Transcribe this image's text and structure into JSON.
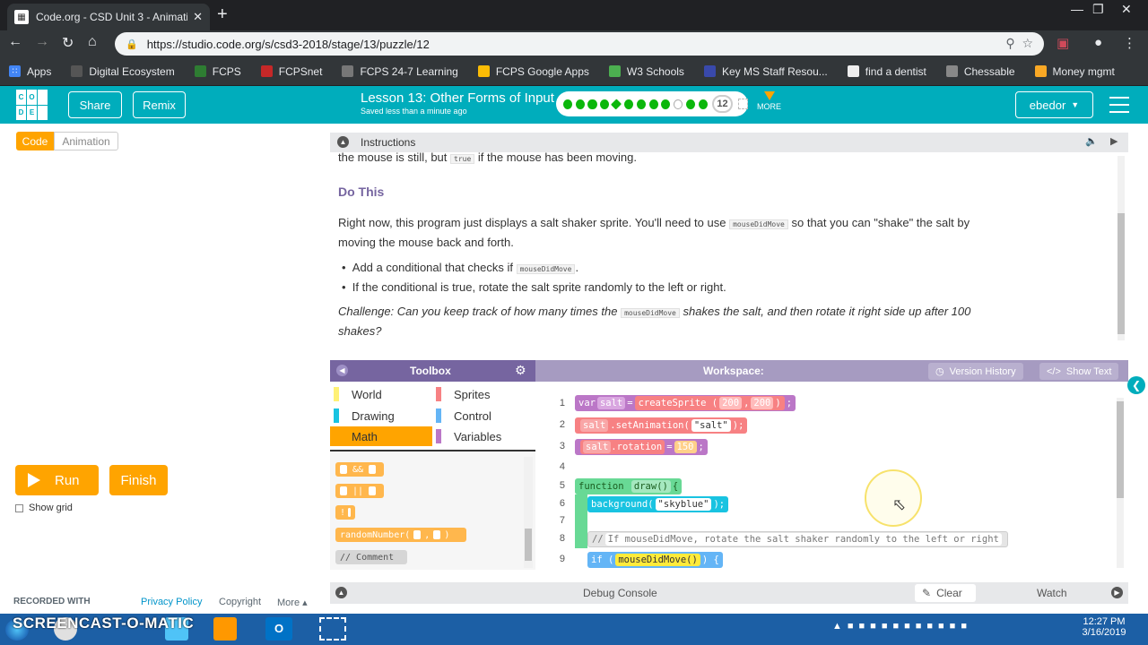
{
  "browser": {
    "tab_title": "Code.org - CSD Unit 3 - Animatio",
    "url": "https://studio.code.org/s/csd3-2018/stage/13/puzzle/12",
    "bookmarks": [
      "Apps",
      "Digital Ecosystem",
      "FCPS",
      "FCPSnet",
      "FCPS 24-7 Learning",
      "FCPS Google Apps",
      "W3 Schools",
      "Key MS Staff Resou...",
      "find a dentist",
      "Chessable",
      "Money mgmt"
    ]
  },
  "header": {
    "logo_letters": [
      "C",
      "O",
      "",
      "D",
      "E",
      ""
    ],
    "share_label": "Share",
    "remix_label": "Remix",
    "lesson_title": "Lesson 13: Other Forms of Input",
    "saved_text": "Saved less than a minute ago",
    "current_level": "12",
    "more_label": "MORE",
    "username": "ebedor"
  },
  "left": {
    "code_tab": "Code",
    "animation_tab": "Animation",
    "run_label": "Run",
    "finish_label": "Finish",
    "show_grid_label": "Show grid",
    "footer_recorded": "RECORDED WITH",
    "footer_privacy": "Privacy Policy",
    "footer_copyright": "Copyright",
    "footer_more": "More ▴"
  },
  "instructions": {
    "header": "Instructions",
    "line_top_a": "the mouse is still, but",
    "line_top_code": "true",
    "line_top_b": "if the mouse has been moving.",
    "do_this": "Do This",
    "p1_a": "Right now, this program just displays a salt shaker sprite. You'll need to use",
    "p1_code": "mouseDidMove",
    "p1_b": "so that you can \"shake\" the salt by",
    "p1_c": "moving the mouse back and forth.",
    "bullet1_a": "Add a conditional that checks if",
    "bullet1_code": "mouseDidMove",
    "bullet1_b": ".",
    "bullet2": "If the conditional is true, rotate the salt sprite randomly to the left or right.",
    "challenge_a": "Challenge: Can you keep track of how many times the",
    "challenge_code": "mouseDidMove",
    "challenge_b": "shakes the salt, and then rotate it right side up after 100",
    "challenge_c": "shakes?"
  },
  "toolbox": {
    "title": "Toolbox",
    "categories": [
      {
        "name": "World",
        "color": "#fff176"
      },
      {
        "name": "Sprites",
        "color": "#f78183"
      },
      {
        "name": "Drawing",
        "color": "#19c3e1"
      },
      {
        "name": "Control",
        "color": "#64b5f6"
      },
      {
        "name": "Math",
        "color": "#ffb74d"
      },
      {
        "name": "Variables",
        "color": "#bb77c7"
      }
    ],
    "blocks": [
      "&&",
      "||",
      "!",
      "randomNumber(",
      "// Comment"
    ]
  },
  "workspace": {
    "title": "Workspace:",
    "version_history": "Version History",
    "show_text": "Show Text",
    "line_numbers": [
      "1",
      "2",
      "3",
      "4",
      "5",
      "6",
      "7",
      "8",
      "9"
    ],
    "l1_var": "var",
    "l1_name": "salt",
    "l1_eq": "=",
    "l1_fn": "createSprite",
    "l1_a": "200",
    "l1_b": "200",
    "l2_obj": "salt",
    "l2_fn": ".setAnimation(",
    "l2_arg": "\"salt\"",
    "l3_obj": "salt",
    "l3_prop": ".rotation",
    "l3_eq": "=",
    "l3_val": "150",
    "l5_fn": "function",
    "l5_name": "draw()",
    "l6_fn": "background(",
    "l6_arg": "\"skyblue\"",
    "l8_comment": "If mouseDidMove, rotate the salt shaker randomly to the left or right",
    "l9_if": "if",
    "l9_cond": "mouseDidMove()"
  },
  "debug": {
    "console_label": "Debug Console",
    "clear_label": "Clear",
    "watch_label": "Watch"
  },
  "taskbar": {
    "time": "12:27 PM",
    "date": "3/16/2019",
    "watermark": "SCREENCAST-O-MATIC"
  }
}
